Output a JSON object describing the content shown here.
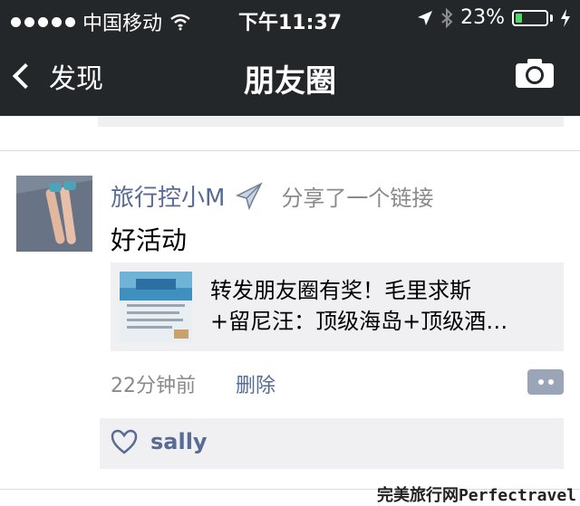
{
  "status": {
    "carrier": "中国移动",
    "time": "下午11:37",
    "battery": "23%",
    "battery_level": 0.23
  },
  "nav": {
    "back_label": "发现",
    "title": "朋友圈"
  },
  "post": {
    "author": "旅行控小M",
    "action": "分享了一个链接",
    "text": "好活动",
    "link": {
      "title_line1": "转发朋友圈有奖！毛里求斯",
      "title_line2": "+留尼汪：顶级海岛+顶级酒…"
    },
    "time": "22分钟前",
    "delete_label": "删除",
    "likes": [
      "sally"
    ]
  },
  "watermark": "完美旅行网Perfectravel"
}
